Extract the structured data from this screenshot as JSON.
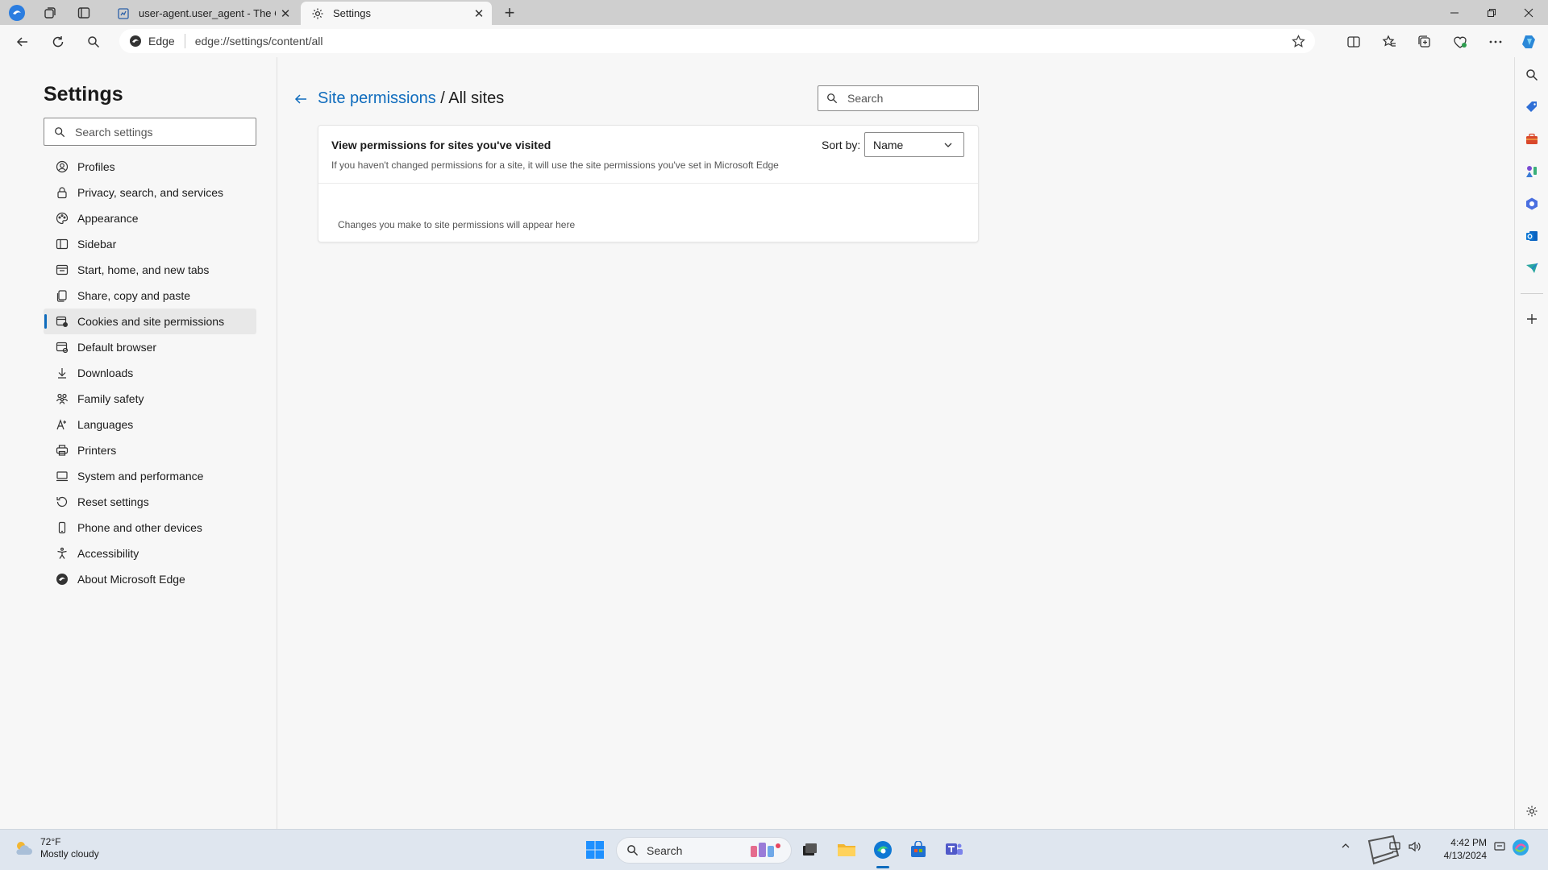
{
  "window": {
    "tabs": [
      {
        "title": "user-agent.user_agent - The Coll",
        "active": false
      },
      {
        "title": "Settings",
        "active": true
      }
    ],
    "controls": {
      "minimize": "—",
      "restore": "❐",
      "close": "✕"
    }
  },
  "address_bar": {
    "site_chip": "Edge",
    "url": "edge://settings/content/all"
  },
  "settings": {
    "title": "Settings",
    "search_placeholder": "Search settings",
    "nav": [
      {
        "label": "Profiles",
        "icon": "profile-icon"
      },
      {
        "label": "Privacy, search, and services",
        "icon": "lock-icon"
      },
      {
        "label": "Appearance",
        "icon": "appearance-icon"
      },
      {
        "label": "Sidebar",
        "icon": "sidebar-icon"
      },
      {
        "label": "Start, home, and new tabs",
        "icon": "home-icon"
      },
      {
        "label": "Share, copy and paste",
        "icon": "share-icon"
      },
      {
        "label": "Cookies and site permissions",
        "icon": "cookies-icon",
        "selected": true
      },
      {
        "label": "Default browser",
        "icon": "browser-icon"
      },
      {
        "label": "Downloads",
        "icon": "download-icon"
      },
      {
        "label": "Family safety",
        "icon": "family-icon"
      },
      {
        "label": "Languages",
        "icon": "language-icon"
      },
      {
        "label": "Printers",
        "icon": "printer-icon"
      },
      {
        "label": "System and performance",
        "icon": "system-icon"
      },
      {
        "label": "Reset settings",
        "icon": "reset-icon"
      },
      {
        "label": "Phone and other devices",
        "icon": "phone-icon"
      },
      {
        "label": "Accessibility",
        "icon": "accessibility-icon"
      },
      {
        "label": "About Microsoft Edge",
        "icon": "edge-icon"
      }
    ]
  },
  "content": {
    "breadcrumb_link": "Site permissions",
    "breadcrumb_current": " / All sites",
    "search_placeholder": "Search",
    "card": {
      "title": "View permissions for sites you've visited",
      "description": "If you haven't changed permissions for a site, it will use the site permissions you've set in Microsoft Edge",
      "sort_label": "Sort by:",
      "sort_value": "Name",
      "empty_message": "Changes you make to site permissions will appear here"
    }
  },
  "taskbar": {
    "weather_temp": "72°F",
    "weather_desc": "Mostly cloudy",
    "search_label": "Search",
    "time": "4:42 PM",
    "date": "4/13/2024"
  },
  "colors": {
    "accent": "#0f6cbd",
    "titlebar": "#cfcfcf",
    "page_bg": "#f7f7f7",
    "taskbar": "#dfe6ef"
  }
}
